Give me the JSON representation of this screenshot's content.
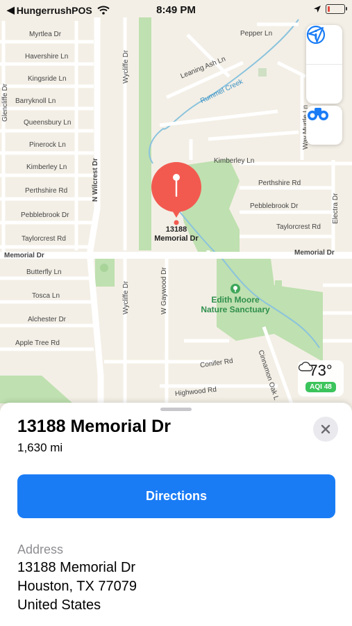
{
  "status_bar": {
    "back_app": "HungerrushPOS",
    "time": "8:49 PM"
  },
  "map": {
    "streets": {
      "myrtlea": "Myrtlea Dr",
      "havershire": "Havershire Ln",
      "kingsride": "Kingsride Ln",
      "barryknoll": "Barryknoll Ln",
      "queensbury": "Queensbury Ln",
      "pinerock": "Pinerock Ln",
      "kimberley_w": "Kimberley Ln",
      "perthshire_w": "Perthshire Rd",
      "pebblebrook_w": "Pebblebrook Dr",
      "taylorcrest_w": "Taylorcrest Rd",
      "memorial_w": "Memorial Dr",
      "butterfly": "Butterfly Ln",
      "tosca": "Tosca Ln",
      "alchester": "Alchester Dr",
      "apple_tree": "Apple Tree Rd",
      "pepper": "Pepper Ln",
      "leaning_ash": "Leaning Ash Ln",
      "rummel_creek": "Rummel Creek",
      "kimberley_e": "Kimberley Ln",
      "perthshire_e": "Perthshire Rd",
      "pebblebrook_e": "Pebblebrook Dr",
      "taylorcrest_e": "Taylorcrest Rd",
      "memorial_e": "Memorial Dr",
      "conifer": "Conifer Rd",
      "highwood": "Highwood Rd",
      "n_wilcrest": "N Wilcrest Dr",
      "wycliffe_n": "Wycliffe Dr",
      "wycliffe_s": "Wycliffe Dr",
      "w_gaywood": "W Gaywood Dr",
      "electra": "Electra Dr",
      "cinnamon_oak": "Cinnamon Oak L",
      "way_murtle": "Way Murtle Ln",
      "glencliffe": "Glencliffe Dr"
    },
    "pin_label_line1": "13188",
    "pin_label_line2": "Memorial Dr",
    "poi_line1": "Edith Moore",
    "poi_line2": "Nature Sanctuary",
    "weather_temp": "73°",
    "aqi": "AQI 48",
    "controls": [
      "info-icon",
      "location-arrow-icon",
      "binoculars-icon"
    ],
    "accent": "#1a7cf5",
    "pin_color": "#f25a50"
  },
  "sheet": {
    "title": "13188 Memorial Dr",
    "distance": "1,630 mi",
    "directions_label": "Directions",
    "address_heading": "Address",
    "address_line1": "13188 Memorial Dr",
    "address_line2": "Houston, TX  77079",
    "address_line3": "United States"
  }
}
